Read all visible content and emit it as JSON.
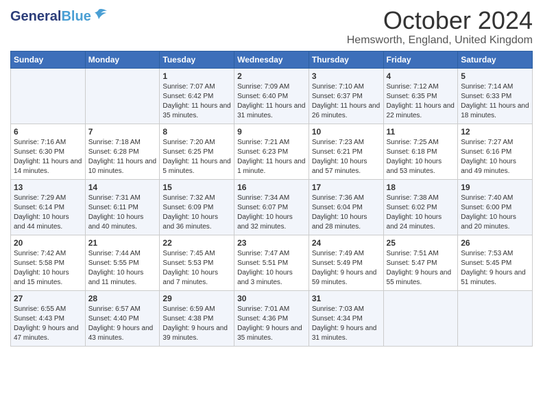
{
  "logo": {
    "general": "General",
    "blue": "Blue",
    "tagline": ""
  },
  "title": "October 2024",
  "location": "Hemsworth, England, United Kingdom",
  "days_of_week": [
    "Sunday",
    "Monday",
    "Tuesday",
    "Wednesday",
    "Thursday",
    "Friday",
    "Saturday"
  ],
  "weeks": [
    [
      {
        "day": "",
        "sunrise": "",
        "sunset": "",
        "daylight": ""
      },
      {
        "day": "",
        "sunrise": "",
        "sunset": "",
        "daylight": ""
      },
      {
        "day": "1",
        "sunrise": "Sunrise: 7:07 AM",
        "sunset": "Sunset: 6:42 PM",
        "daylight": "Daylight: 11 hours and 35 minutes."
      },
      {
        "day": "2",
        "sunrise": "Sunrise: 7:09 AM",
        "sunset": "Sunset: 6:40 PM",
        "daylight": "Daylight: 11 hours and 31 minutes."
      },
      {
        "day": "3",
        "sunrise": "Sunrise: 7:10 AM",
        "sunset": "Sunset: 6:37 PM",
        "daylight": "Daylight: 11 hours and 26 minutes."
      },
      {
        "day": "4",
        "sunrise": "Sunrise: 7:12 AM",
        "sunset": "Sunset: 6:35 PM",
        "daylight": "Daylight: 11 hours and 22 minutes."
      },
      {
        "day": "5",
        "sunrise": "Sunrise: 7:14 AM",
        "sunset": "Sunset: 6:33 PM",
        "daylight": "Daylight: 11 hours and 18 minutes."
      }
    ],
    [
      {
        "day": "6",
        "sunrise": "Sunrise: 7:16 AM",
        "sunset": "Sunset: 6:30 PM",
        "daylight": "Daylight: 11 hours and 14 minutes."
      },
      {
        "day": "7",
        "sunrise": "Sunrise: 7:18 AM",
        "sunset": "Sunset: 6:28 PM",
        "daylight": "Daylight: 11 hours and 10 minutes."
      },
      {
        "day": "8",
        "sunrise": "Sunrise: 7:20 AM",
        "sunset": "Sunset: 6:25 PM",
        "daylight": "Daylight: 11 hours and 5 minutes."
      },
      {
        "day": "9",
        "sunrise": "Sunrise: 7:21 AM",
        "sunset": "Sunset: 6:23 PM",
        "daylight": "Daylight: 11 hours and 1 minute."
      },
      {
        "day": "10",
        "sunrise": "Sunrise: 7:23 AM",
        "sunset": "Sunset: 6:21 PM",
        "daylight": "Daylight: 10 hours and 57 minutes."
      },
      {
        "day": "11",
        "sunrise": "Sunrise: 7:25 AM",
        "sunset": "Sunset: 6:18 PM",
        "daylight": "Daylight: 10 hours and 53 minutes."
      },
      {
        "day": "12",
        "sunrise": "Sunrise: 7:27 AM",
        "sunset": "Sunset: 6:16 PM",
        "daylight": "Daylight: 10 hours and 49 minutes."
      }
    ],
    [
      {
        "day": "13",
        "sunrise": "Sunrise: 7:29 AM",
        "sunset": "Sunset: 6:14 PM",
        "daylight": "Daylight: 10 hours and 44 minutes."
      },
      {
        "day": "14",
        "sunrise": "Sunrise: 7:31 AM",
        "sunset": "Sunset: 6:11 PM",
        "daylight": "Daylight: 10 hours and 40 minutes."
      },
      {
        "day": "15",
        "sunrise": "Sunrise: 7:32 AM",
        "sunset": "Sunset: 6:09 PM",
        "daylight": "Daylight: 10 hours and 36 minutes."
      },
      {
        "day": "16",
        "sunrise": "Sunrise: 7:34 AM",
        "sunset": "Sunset: 6:07 PM",
        "daylight": "Daylight: 10 hours and 32 minutes."
      },
      {
        "day": "17",
        "sunrise": "Sunrise: 7:36 AM",
        "sunset": "Sunset: 6:04 PM",
        "daylight": "Daylight: 10 hours and 28 minutes."
      },
      {
        "day": "18",
        "sunrise": "Sunrise: 7:38 AM",
        "sunset": "Sunset: 6:02 PM",
        "daylight": "Daylight: 10 hours and 24 minutes."
      },
      {
        "day": "19",
        "sunrise": "Sunrise: 7:40 AM",
        "sunset": "Sunset: 6:00 PM",
        "daylight": "Daylight: 10 hours and 20 minutes."
      }
    ],
    [
      {
        "day": "20",
        "sunrise": "Sunrise: 7:42 AM",
        "sunset": "Sunset: 5:58 PM",
        "daylight": "Daylight: 10 hours and 15 minutes."
      },
      {
        "day": "21",
        "sunrise": "Sunrise: 7:44 AM",
        "sunset": "Sunset: 5:55 PM",
        "daylight": "Daylight: 10 hours and 11 minutes."
      },
      {
        "day": "22",
        "sunrise": "Sunrise: 7:45 AM",
        "sunset": "Sunset: 5:53 PM",
        "daylight": "Daylight: 10 hours and 7 minutes."
      },
      {
        "day": "23",
        "sunrise": "Sunrise: 7:47 AM",
        "sunset": "Sunset: 5:51 PM",
        "daylight": "Daylight: 10 hours and 3 minutes."
      },
      {
        "day": "24",
        "sunrise": "Sunrise: 7:49 AM",
        "sunset": "Sunset: 5:49 PM",
        "daylight": "Daylight: 9 hours and 59 minutes."
      },
      {
        "day": "25",
        "sunrise": "Sunrise: 7:51 AM",
        "sunset": "Sunset: 5:47 PM",
        "daylight": "Daylight: 9 hours and 55 minutes."
      },
      {
        "day": "26",
        "sunrise": "Sunrise: 7:53 AM",
        "sunset": "Sunset: 5:45 PM",
        "daylight": "Daylight: 9 hours and 51 minutes."
      }
    ],
    [
      {
        "day": "27",
        "sunrise": "Sunrise: 6:55 AM",
        "sunset": "Sunset: 4:43 PM",
        "daylight": "Daylight: 9 hours and 47 minutes."
      },
      {
        "day": "28",
        "sunrise": "Sunrise: 6:57 AM",
        "sunset": "Sunset: 4:40 PM",
        "daylight": "Daylight: 9 hours and 43 minutes."
      },
      {
        "day": "29",
        "sunrise": "Sunrise: 6:59 AM",
        "sunset": "Sunset: 4:38 PM",
        "daylight": "Daylight: 9 hours and 39 minutes."
      },
      {
        "day": "30",
        "sunrise": "Sunrise: 7:01 AM",
        "sunset": "Sunset: 4:36 PM",
        "daylight": "Daylight: 9 hours and 35 minutes."
      },
      {
        "day": "31",
        "sunrise": "Sunrise: 7:03 AM",
        "sunset": "Sunset: 4:34 PM",
        "daylight": "Daylight: 9 hours and 31 minutes."
      },
      {
        "day": "",
        "sunrise": "",
        "sunset": "",
        "daylight": ""
      },
      {
        "day": "",
        "sunrise": "",
        "sunset": "",
        "daylight": ""
      }
    ]
  ]
}
